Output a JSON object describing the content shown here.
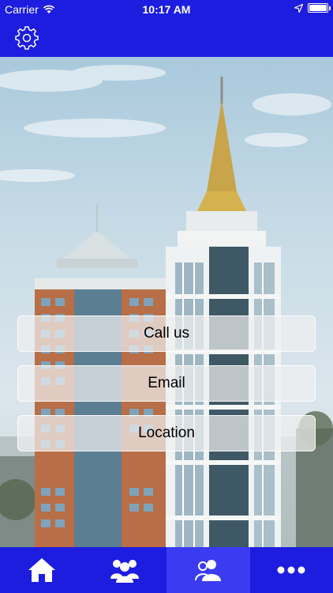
{
  "status_bar": {
    "carrier": "Carrier",
    "time": "10:17 AM"
  },
  "nav": {
    "settings_icon": "gear-icon"
  },
  "actions": {
    "call_label": "Call us",
    "email_label": "Email",
    "location_label": "Location"
  },
  "tabs": [
    {
      "icon": "home-icon",
      "active": false
    },
    {
      "icon": "group-icon",
      "active": false
    },
    {
      "icon": "contacts-icon",
      "active": true
    },
    {
      "icon": "more-icon",
      "active": false
    }
  ],
  "colors": {
    "brand_blue": "#1d1de0",
    "active_tab": "#3b3bf2"
  }
}
